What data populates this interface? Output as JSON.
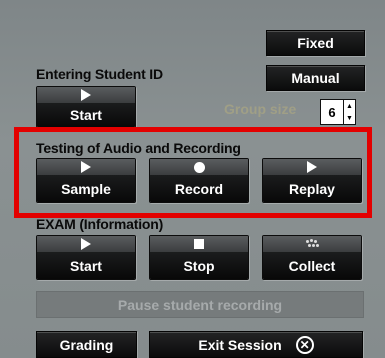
{
  "entering": {
    "title": "Entering Student ID",
    "start_label": "Start"
  },
  "mode_buttons": {
    "fixed_label": "Fixed",
    "manual_label": "Manual"
  },
  "group_size": {
    "label": "Group size",
    "value": "6"
  },
  "testing": {
    "title": "Testing of Audio and Recording",
    "sample_label": "Sample",
    "record_label": "Record",
    "replay_label": "Replay"
  },
  "exam": {
    "title": "EXAM (Information)",
    "start_label": "Start",
    "stop_label": "Stop",
    "collect_label": "Collect",
    "pause_label": "Pause student recording"
  },
  "footer": {
    "grading_label": "Grading",
    "exit_label": "Exit Session"
  },
  "colors": {
    "highlight": "#e30000",
    "panel": "#848b8c"
  }
}
